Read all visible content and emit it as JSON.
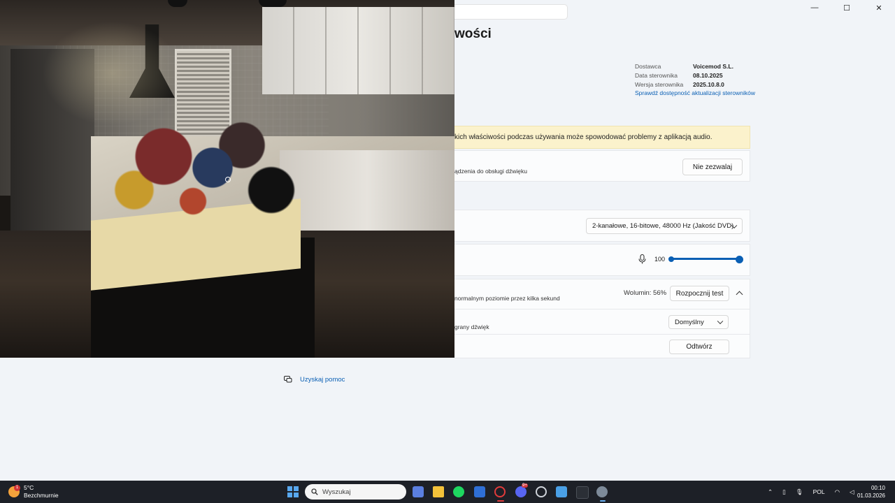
{
  "window": {
    "title_partial": "wości",
    "controls": {
      "minimize": "—",
      "maximize": "☐",
      "close": "✕"
    }
  },
  "properties": {
    "rows": [
      {
        "key": "Dostawca",
        "value": "Voicemod S.L."
      },
      {
        "key": "Data sterownika",
        "value": "08.10.2025"
      },
      {
        "key": "Wersja sterownika",
        "value": "2025.10.8.0"
      }
    ],
    "update_link": "Sprawdź dostępność aktualizacji sterowników"
  },
  "warning": {
    "text": "kich właściwości podczas używania może spowodować problemy z aplikacją audio."
  },
  "exclusive": {
    "desc": "ądzenia do obsługi dźwięku",
    "button": "Nie zezwalaj"
  },
  "format": {
    "value": "2-kanałowe, 16-bitowe, 48000 Hz (Jakość DVD)"
  },
  "volume": {
    "value": "100",
    "level": 100,
    "accent": "#0a5fb4"
  },
  "test": {
    "desc": "normalnym poziomie przez kilka sekund",
    "volume_label": "Wolumin: 56%",
    "button": "Rozpocznij test",
    "sound_desc": "grany dźwięk",
    "sound_value": "Domyślny",
    "play_button": "Odtwórz"
  },
  "help": {
    "label": "Uzyskaj pomoc"
  },
  "taskbar": {
    "weather": {
      "temp": "5°C",
      "desc": "Bezchmurnie",
      "badge": "1"
    },
    "search_placeholder": "Wyszukaj",
    "apps": [
      "store-icon",
      "folder-icon",
      "spotify-icon",
      "mail-icon",
      "opera-icon",
      "discord-icon",
      "steam-icon",
      "app-icon",
      "terminal-icon",
      "settings-icon"
    ],
    "discord_badge": "9+",
    "language": "POL",
    "time": "00:10",
    "date": "01.03.2026"
  }
}
